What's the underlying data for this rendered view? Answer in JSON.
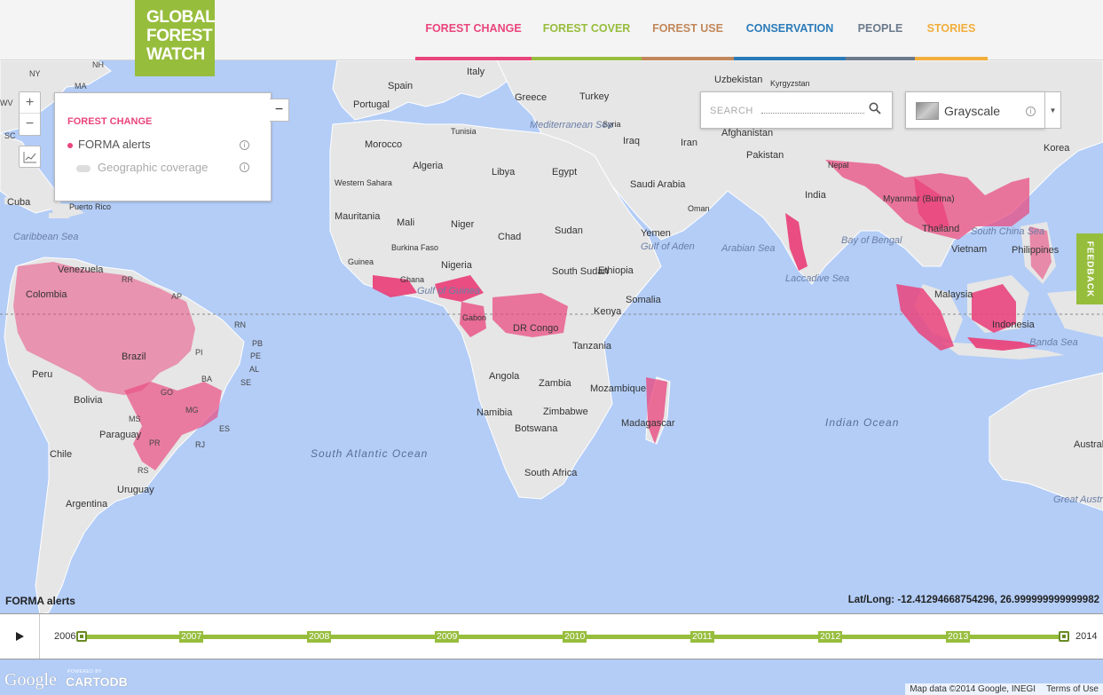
{
  "logo": {
    "lines": [
      "GLOBAL",
      "FOREST",
      "WATCH"
    ]
  },
  "nav": [
    {
      "label": "FOREST CHANGE",
      "color": "#e9457c"
    },
    {
      "label": "FOREST COVER",
      "color": "#97bd3d"
    },
    {
      "label": "FOREST USE",
      "color": "#c1875a"
    },
    {
      "label": "CONSERVATION",
      "color": "#2b7bb9"
    },
    {
      "label": "PEOPLE",
      "color": "#6c7a8c"
    },
    {
      "label": "STORIES",
      "color": "#f2ae3b"
    }
  ],
  "zoom": {
    "in": "+",
    "out": "−"
  },
  "layer_panel": {
    "title": "FOREST CHANGE",
    "layers": [
      {
        "label": "FORMA alerts",
        "active": true,
        "color": "#e9457c"
      },
      {
        "label": "Geographic coverage",
        "active": false
      }
    ],
    "minimize": "−"
  },
  "search": {
    "placeholder": "SEARCH"
  },
  "basemap": {
    "label": "Grayscale"
  },
  "feedback": {
    "label": "FEEDBACK"
  },
  "map": {
    "countries": [
      "Italy",
      "Spain",
      "Portugal",
      "Greece",
      "Turkey",
      "Tunisia",
      "Syria",
      "Iraq",
      "Iran",
      "Morocco",
      "Algeria",
      "Libya",
      "Egypt",
      "Western Sahara",
      "Mauritania",
      "Mali",
      "Niger",
      "Chad",
      "Sudan",
      "Saudi Arabia",
      "Oman",
      "Yemen",
      "Burkina Faso",
      "Guinea",
      "Ghana",
      "Nigeria",
      "South Sudan",
      "Ethiopia",
      "Somalia",
      "Gabon",
      "DR Congo",
      "Kenya",
      "Tanzania",
      "Angola",
      "Zambia",
      "Mozambique",
      "Namibia",
      "Zimbabwe",
      "Botswana",
      "South Africa",
      "Madagascar",
      "Uzbekistan",
      "Kyrgyzstan",
      "Afghanistan",
      "Pakistan",
      "Nepal",
      "India",
      "Myanmar (Burma)",
      "Thailand",
      "Vietnam",
      "Philippines",
      "Malaysia",
      "Indonesia",
      "Korea",
      "Venezuela",
      "Colombia",
      "Peru",
      "Brazil",
      "Bolivia",
      "Paraguay",
      "Chile",
      "Uruguay",
      "Argentina",
      "Cuba",
      "Puerto Rico",
      "Austral"
    ],
    "seas": [
      "Mediterranean Sea",
      "Caribbean Sea",
      "Gulf of Guinea",
      "Gulf of Aden",
      "Arabian Sea",
      "Bay of Bengal",
      "Laccadive Sea",
      "South China Sea",
      "Banda Sea",
      "Great Australian Bight"
    ],
    "oceans": [
      "South Atlantic Ocean",
      "Indian Ocean"
    ],
    "states": [
      "NY",
      "MA",
      "NH",
      "WV",
      "SC",
      "RN",
      "PB",
      "PE",
      "AL",
      "SE",
      "PI",
      "BA",
      "GO",
      "MS",
      "MG",
      "ES",
      "PR",
      "RJ",
      "RS",
      "AP",
      "RR"
    ]
  },
  "layer_caption": "FORMA alerts",
  "latlong": "Lat/Long: -12.41294668754296, 26.999999999999982",
  "timeline": {
    "start_label": "2006",
    "end_label": "2014",
    "years": [
      "2007",
      "2008",
      "2009",
      "2010",
      "2011",
      "2012",
      "2013"
    ],
    "range": {
      "start": "2006",
      "end": "2014"
    }
  },
  "footer": {
    "google": "Google",
    "powered_by": "POWERED BY",
    "cartodb": "CARTODB",
    "map_data": "Map data ©2014 Google, INEGI",
    "terms": "Terms of Use"
  },
  "colors": {
    "alert": "#e9457c",
    "water": "#b3cdf7",
    "land": "#e6e6e6",
    "accent": "#97bd3d"
  }
}
